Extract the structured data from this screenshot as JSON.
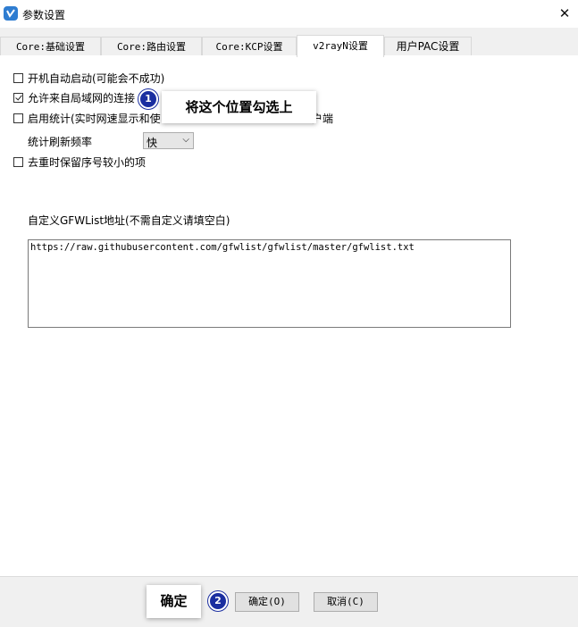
{
  "window": {
    "title": "参数设置",
    "close_glyph": "✕"
  },
  "tabs": [
    {
      "label": "Core:基础设置",
      "active": false
    },
    {
      "label": "Core:路由设置",
      "active": false
    },
    {
      "label": "Core:KCP设置",
      "active": false
    },
    {
      "label": "v2rayN设置",
      "active": true
    },
    {
      "label": "用户PAC设置",
      "active": false
    }
  ],
  "options": [
    {
      "label": "开机自动启动(可能会不成功)",
      "checked": false
    },
    {
      "label": "允许来自局域网的连接",
      "checked": true
    },
    {
      "label": "启用统计(实时网速显示和使",
      "checked": false
    },
    {
      "label": "去重时保留序号较小的项",
      "checked": false
    }
  ],
  "statistics": {
    "option_label_tail": "户端",
    "frequency_label": "统计刷新频率",
    "frequency_value": "快"
  },
  "gfwlist": {
    "label": "自定义GFWList地址(不需自定义请填空白)",
    "url": "https://raw.githubusercontent.com/gfwlist/gfwlist/master/gfwlist.txt"
  },
  "buttons": {
    "ok": "确定(O)",
    "cancel": "取消(C)"
  },
  "annotations": {
    "step1_number": "1",
    "step1_text": "将这个位置勾选上",
    "step2_number": "2",
    "step2_text": "确定"
  },
  "colors": {
    "badge": "#1a2ea0",
    "app_icon": "#2f7dd1"
  }
}
